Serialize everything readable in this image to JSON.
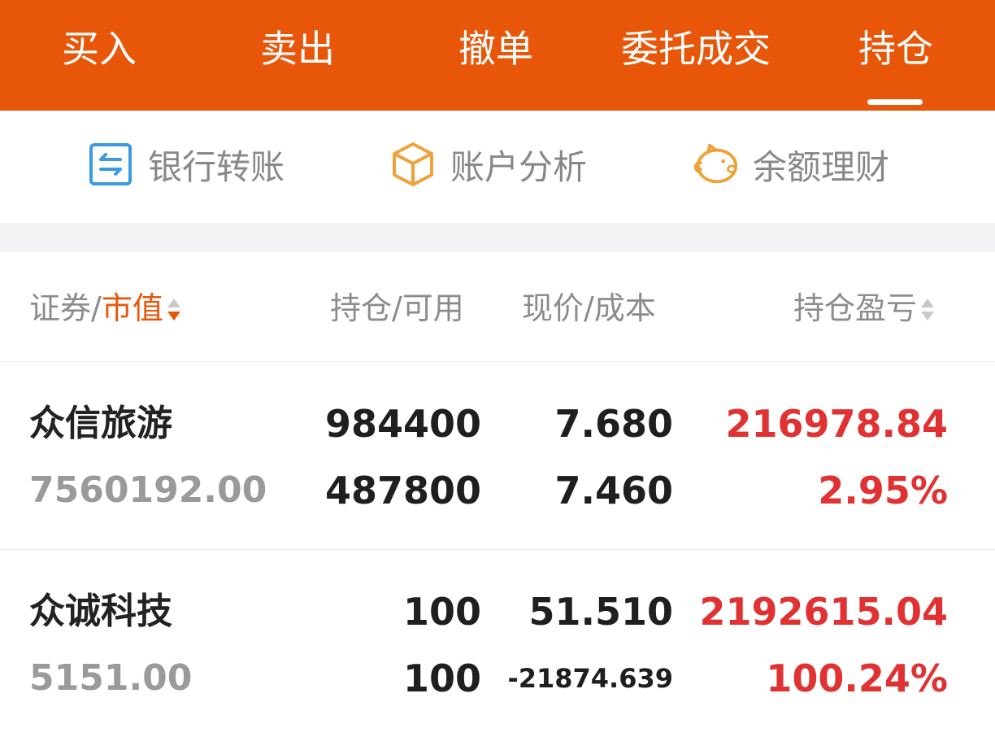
{
  "tabs": [
    {
      "label": "买入"
    },
    {
      "label": "卖出"
    },
    {
      "label": "撤单"
    },
    {
      "label": "委托成交"
    },
    {
      "label": "持仓"
    }
  ],
  "active_tab": "持仓",
  "quick_actions": [
    {
      "label": "银行转账",
      "icon": "bank-transfer-icon",
      "color": "#3a9be0"
    },
    {
      "label": "账户分析",
      "icon": "cube-icon",
      "color": "#f0a23a"
    },
    {
      "label": "余额理财",
      "icon": "piggy-bank-icon",
      "color": "#f0a23a"
    }
  ],
  "table": {
    "headers": {
      "security_prefix": "证券/",
      "security_active": "市值",
      "position": "持仓/可用",
      "price": "现价/成本",
      "pnl": "持仓盈亏"
    },
    "rows": [
      {
        "name": "众信旅游",
        "market_value": "7560192.00",
        "position": "984400",
        "available": "487800",
        "price": "7.680",
        "cost": "7.460",
        "pnl": "216978.84",
        "pnl_pct": "2.95%"
      },
      {
        "name": "众诚科技",
        "market_value": "5151.00",
        "position": "100",
        "available": "100",
        "price": "51.510",
        "cost": "-21874.639",
        "pnl": "2192615.04",
        "pnl_pct": "100.24%"
      }
    ]
  },
  "colors": {
    "brand": "#e8560a",
    "profit": "#e03232"
  }
}
